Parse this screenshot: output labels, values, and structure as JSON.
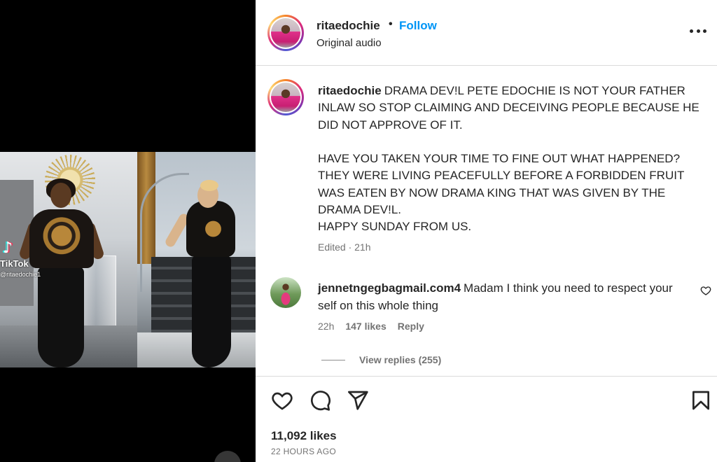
{
  "media": {
    "watermark_brand": "TikTok",
    "watermark_handle": "@ritaedochie1"
  },
  "header": {
    "username": "ritaedochie",
    "separator": "•",
    "follow_label": "Follow",
    "audio_label": "Original audio",
    "more_icon": "more-horizontal-icon"
  },
  "caption": {
    "username": "ritaedochie",
    "text": "DRAMA DEV!L PETE EDOCHIE IS NOT YOUR FATHER INLAW SO STOP CLAIMING AND DECEIVING PEOPLE BECAUSE HE DID NOT APPROVE OF IT.\n\nHAVE YOU TAKEN YOUR TIME TO FINE OUT WHAT HAPPENED? THEY WERE LIVING PEACEFULLY BEFORE A FORBIDDEN FRUIT WAS EATEN BY NOW DRAMA KING THAT WAS GIVEN BY THE DRAMA DEV!L.\nHAPPY SUNDAY FROM US.",
    "edited": "Edited · 21h"
  },
  "comment": {
    "username": "jennetngegbagmail.com4",
    "text": "Madam I think you need to respect your self on this whole thing",
    "time": "22h",
    "likes": "147 likes",
    "reply_label": "Reply",
    "view_replies": "View replies (255)"
  },
  "actions": {
    "icons": [
      "heart-icon",
      "comment-icon",
      "share-icon",
      "bookmark-icon"
    ]
  },
  "footer": {
    "likes": "11,092 likes",
    "time_ago": "22 HOURS AGO"
  },
  "colors": {
    "link_blue": "#0095f6",
    "text": "#262626",
    "secondary": "#737373",
    "border": "#dbdbdb"
  }
}
